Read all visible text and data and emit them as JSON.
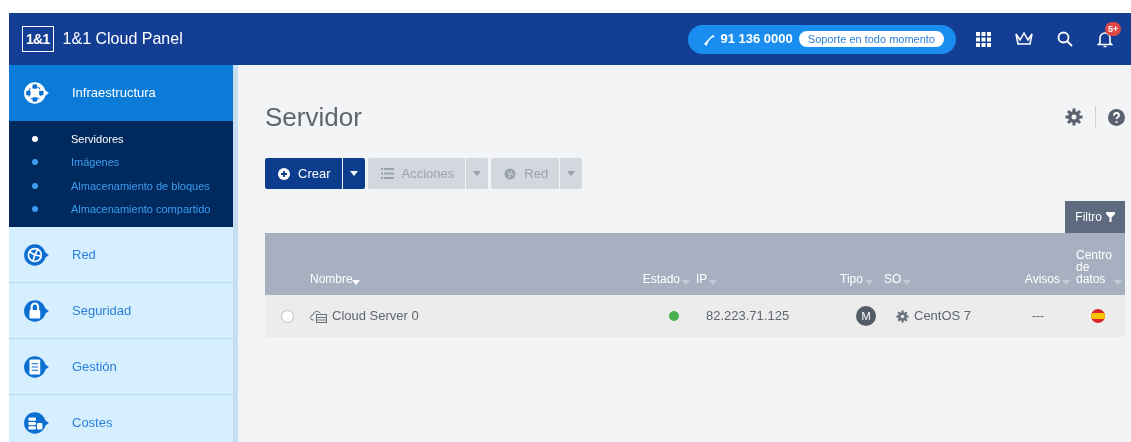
{
  "header": {
    "logo": "1&1",
    "title": "1&1 Cloud Panel",
    "phone": "91 136 0000",
    "support": "Soporte en todo momento",
    "notifications": "5+"
  },
  "sidebar": [
    {
      "kind": "infra",
      "label": "Infraestructura",
      "selected": true,
      "children": [
        {
          "label": "Servidores",
          "selected": true
        },
        {
          "label": "Imágenes",
          "selected": false
        },
        {
          "label": "Almacenamiento de bloques",
          "selected": false
        },
        {
          "label": "Almacenamiento compartido",
          "selected": false
        }
      ]
    },
    {
      "kind": "network",
      "label": "Red",
      "selected": false
    },
    {
      "kind": "lock",
      "label": "Seguridad",
      "selected": false
    },
    {
      "kind": "clipboard",
      "label": "Gestión",
      "selected": false
    },
    {
      "kind": "coins",
      "label": "Costes",
      "selected": false
    }
  ],
  "page": {
    "title": "Servidor"
  },
  "toolbar": [
    {
      "kind": "create",
      "label": "Crear",
      "disabled": false
    },
    {
      "kind": "list",
      "label": "Acciones",
      "disabled": true
    },
    {
      "kind": "network",
      "label": "Red",
      "disabled": true
    }
  ],
  "filter": "Filtro",
  "table": {
    "columns": [
      {
        "label": "Nombre",
        "sorted": true
      },
      {
        "label": "Estado",
        "sorted": false
      },
      {
        "label": "IP",
        "sorted": false
      },
      {
        "label": "Tipo",
        "sorted": false
      },
      {
        "label": "SO",
        "sorted": false
      },
      {
        "label": "Avisos",
        "sorted": false
      },
      {
        "label": "Centro de datos",
        "sorted": false
      }
    ],
    "rows": [
      {
        "selected": false,
        "name": "Cloud Server 0",
        "color": "#4cb050",
        "ip": "82.223.71.125",
        "type": "M",
        "os": "CentOS 7",
        "alerts": "---"
      }
    ]
  }
}
